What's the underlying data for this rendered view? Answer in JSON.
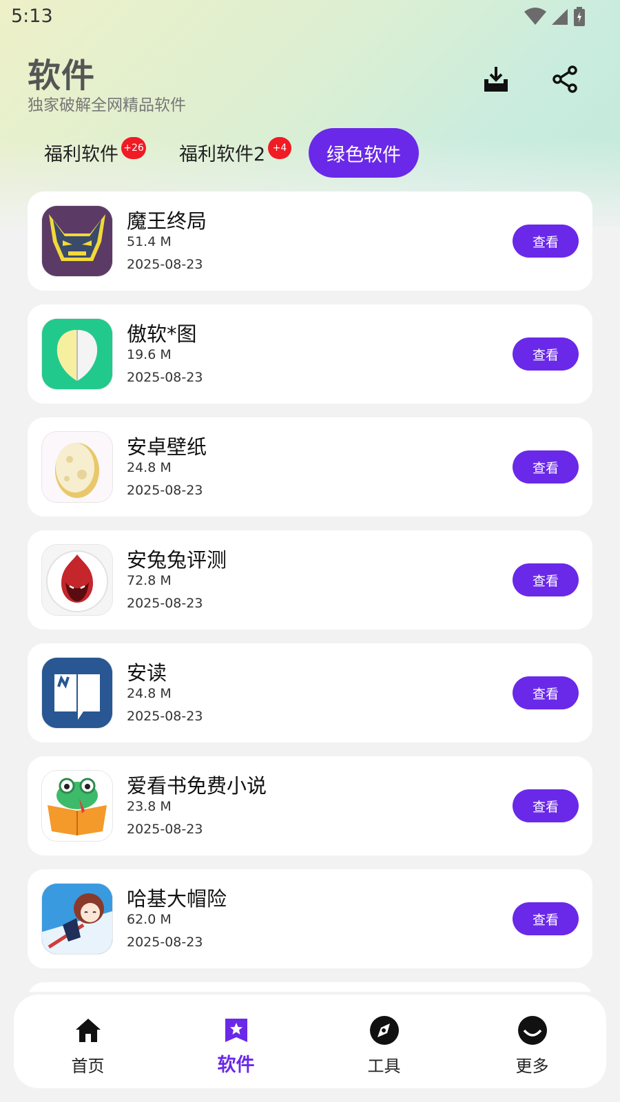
{
  "status_bar": {
    "time": "5:13"
  },
  "header": {
    "title": "软件",
    "subtitle": "独家破解全网精品软件",
    "download_icon": "download-tray-icon",
    "share_icon": "share-icon"
  },
  "tabs": [
    {
      "label": "福利软件",
      "badge": "+26",
      "active": false
    },
    {
      "label": "福利软件2",
      "badge": "+4",
      "active": false
    },
    {
      "label": "绿色软件",
      "badge": "",
      "active": true
    }
  ],
  "apps": [
    {
      "name": "魔王终局",
      "size": "51.4 M",
      "date": "2025-08-23",
      "action": "查看",
      "icon": "demon-wolf-icon"
    },
    {
      "name": "傲软*图",
      "size": "19.6 M",
      "date": "2025-08-23",
      "action": "查看",
      "icon": "cutout-leaf-icon"
    },
    {
      "name": "安卓壁纸",
      "size": "24.8 M",
      "date": "2025-08-23",
      "action": "查看",
      "icon": "egg-icon"
    },
    {
      "name": "安兔兔评测",
      "size": "72.8 M",
      "date": "2025-08-23",
      "action": "查看",
      "icon": "flame-bunny-icon"
    },
    {
      "name": "安读",
      "size": "24.8 M",
      "date": "2025-08-23",
      "action": "查看",
      "icon": "open-book-icon"
    },
    {
      "name": "爱看书免费小说",
      "size": "23.8 M",
      "date": "2025-08-23",
      "action": "查看",
      "icon": "frog-book-icon"
    },
    {
      "name": "哈基大帽险",
      "size": "62.0 M",
      "date": "2025-08-23",
      "action": "查看",
      "icon": "anime-character-icon"
    }
  ],
  "bottom_nav": [
    {
      "label": "首页",
      "icon": "home-icon",
      "active": false
    },
    {
      "label": "软件",
      "icon": "star-bookmark-icon",
      "active": true
    },
    {
      "label": "工具",
      "icon": "compass-icon",
      "active": false
    },
    {
      "label": "更多",
      "icon": "smile-circle-icon",
      "active": false
    }
  ],
  "colors": {
    "accent": "#6a29e8",
    "badge": "#f01b24",
    "card": "#ffffff",
    "page_bg": "#f2f2f2"
  }
}
